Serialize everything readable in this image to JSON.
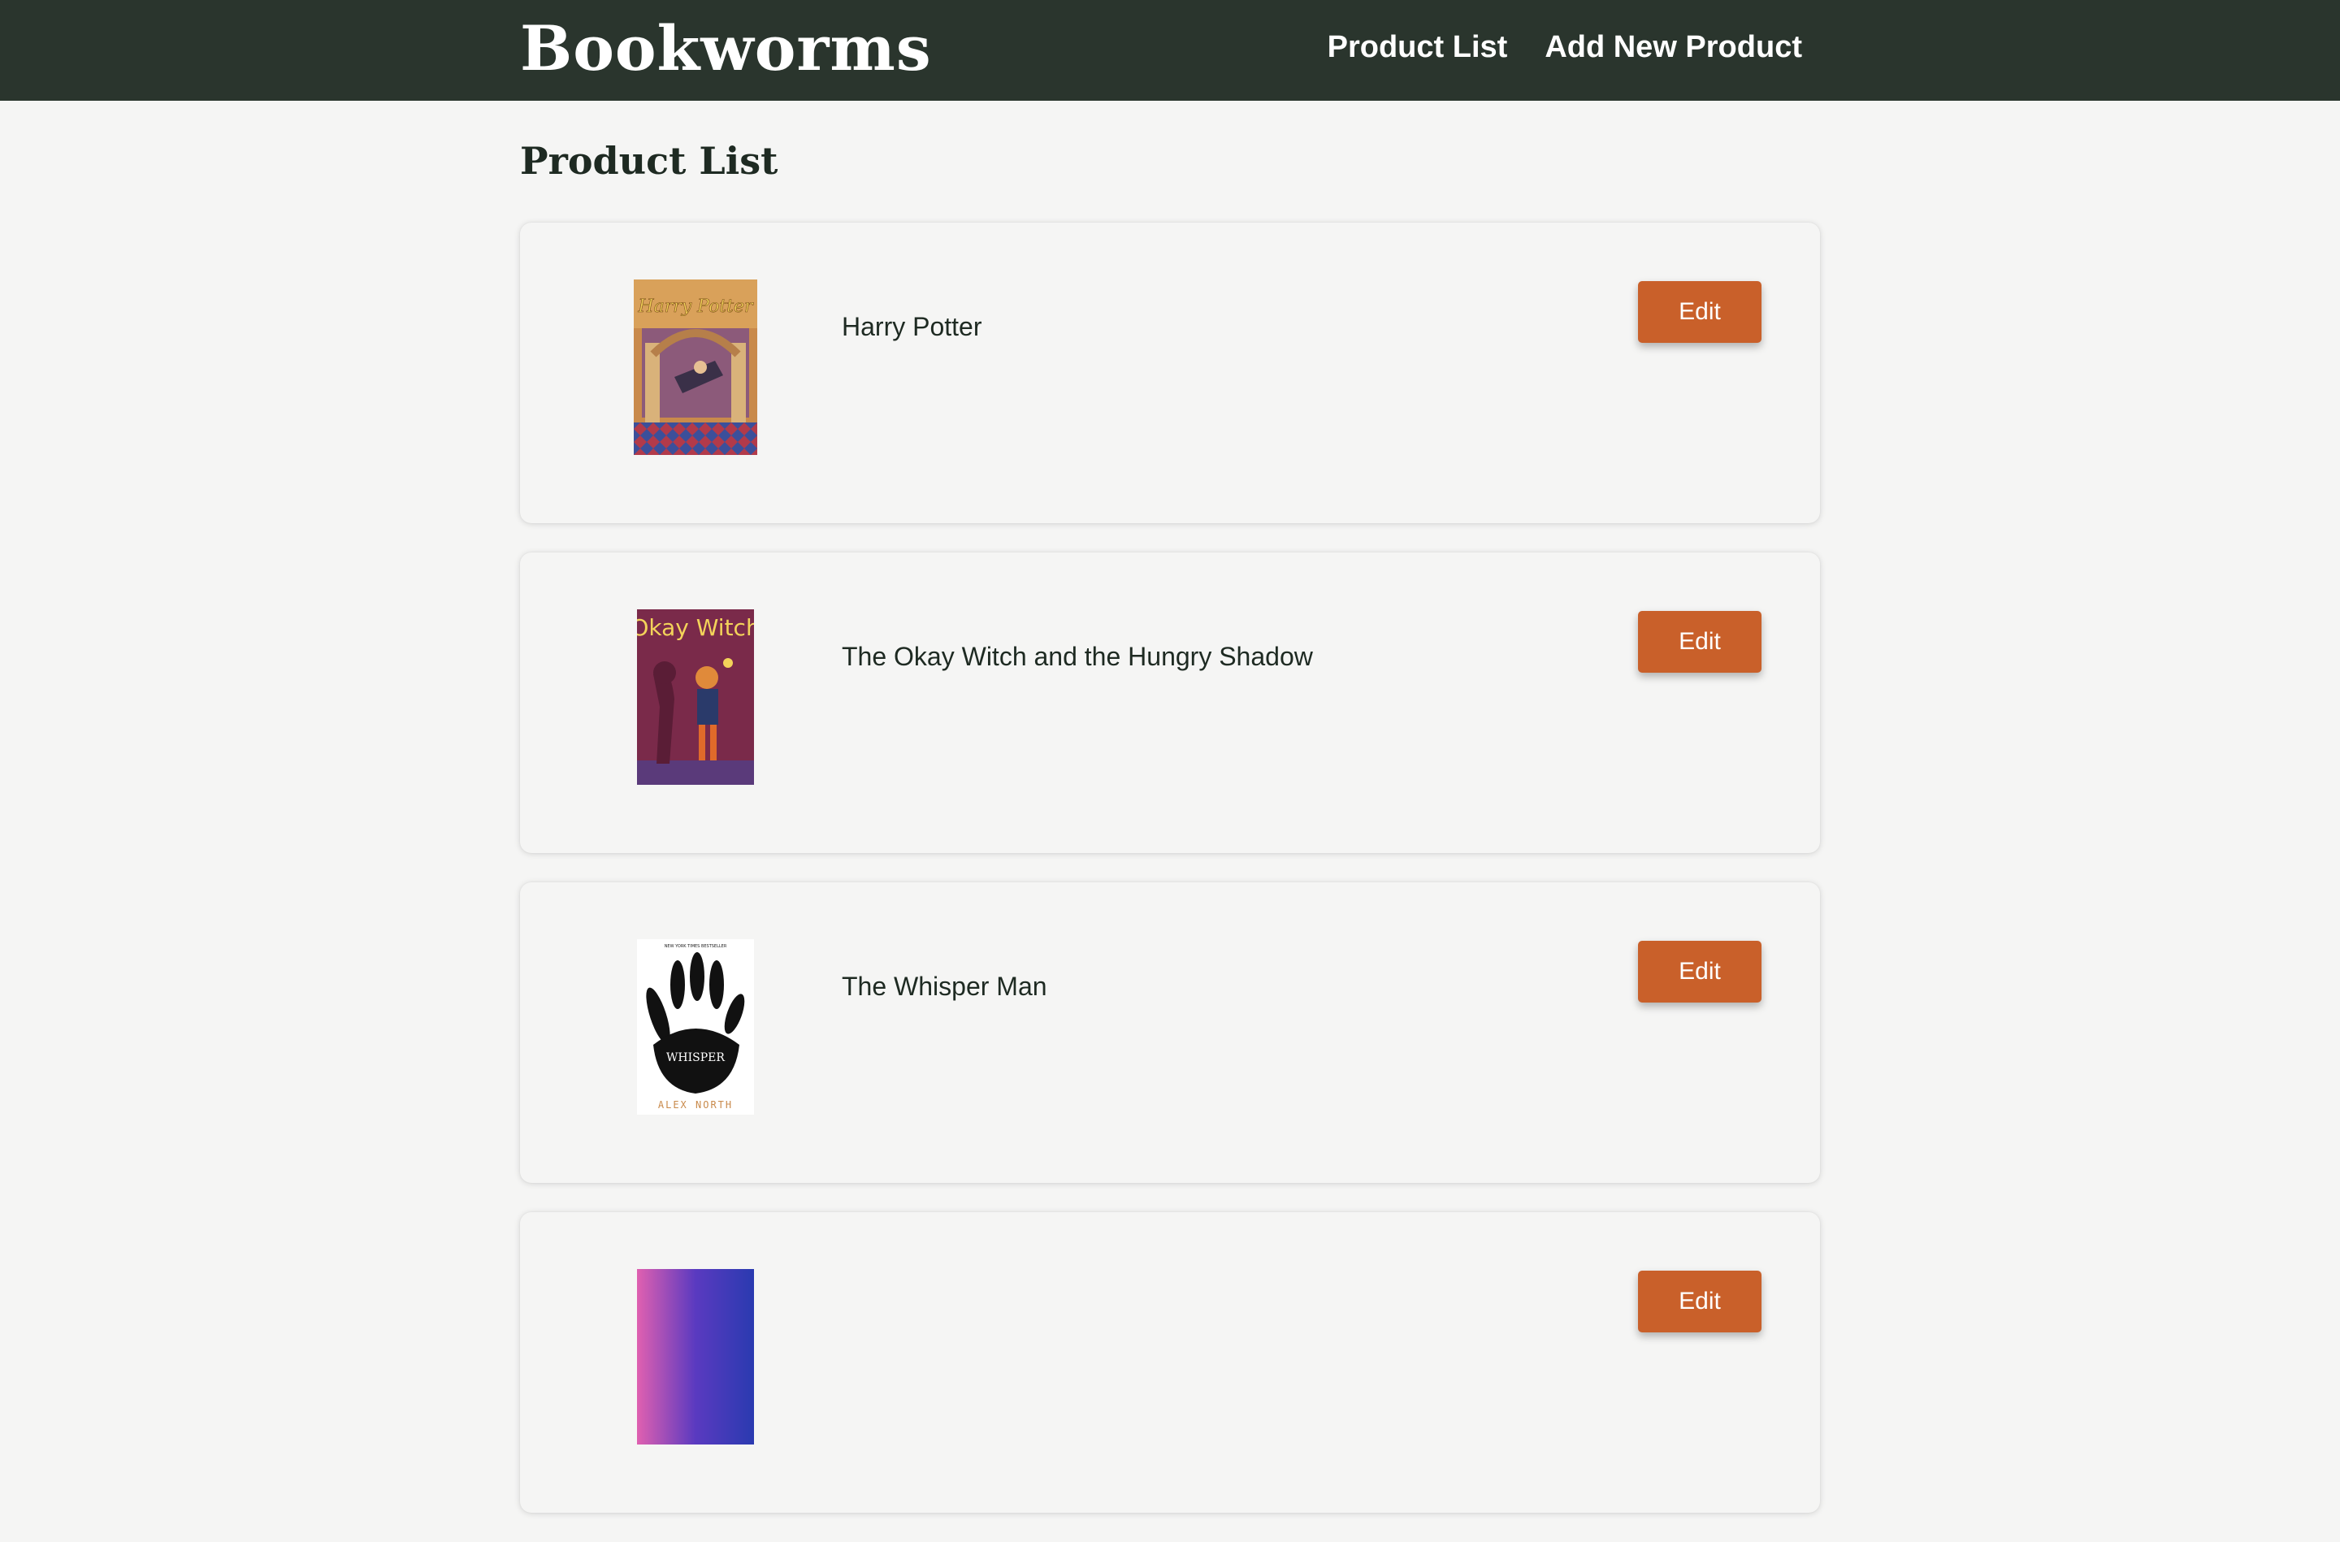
{
  "header": {
    "brand": "Bookworms",
    "nav": [
      {
        "label": "Product List"
      },
      {
        "label": "Add New Product"
      }
    ]
  },
  "main": {
    "title": "Product List",
    "products": [
      {
        "title": "Harry Potter",
        "edit_label": "Edit",
        "cover_text": [
          "Harry Potter"
        ]
      },
      {
        "title": "The Okay Witch and the Hungry Shadow",
        "edit_label": "Edit",
        "cover_text": [
          "Okay Witch"
        ]
      },
      {
        "title": "The Whisper Man",
        "edit_label": "Edit",
        "cover_text": [
          "NEW YORK TIMES BESTSELLER",
          "WHISPER",
          "ALEX NORTH"
        ]
      },
      {
        "title": "",
        "edit_label": "Edit"
      }
    ]
  },
  "colors": {
    "navbar": "#2a352d",
    "page_bg": "#f5f5f4",
    "accent": "#c9602a",
    "text": "#1e2a22"
  }
}
